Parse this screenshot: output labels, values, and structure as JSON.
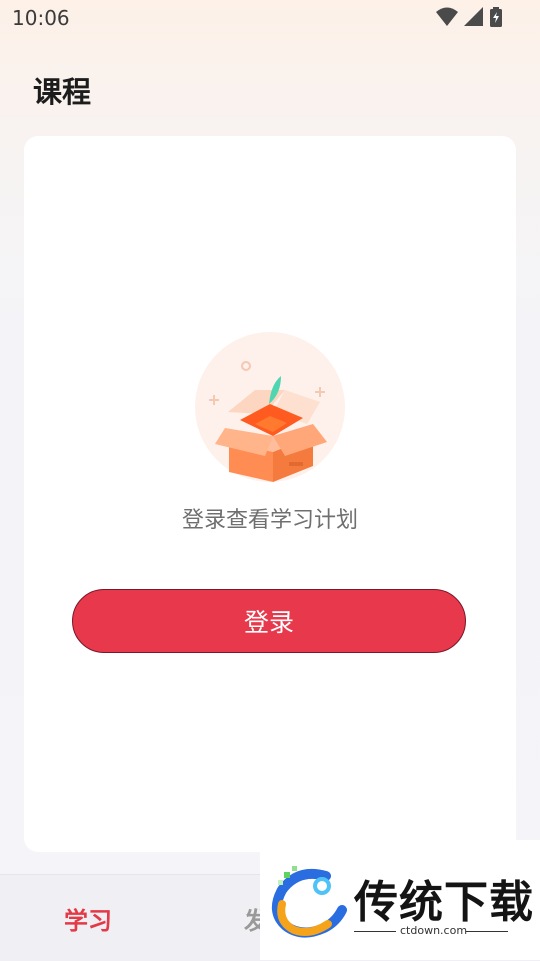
{
  "status_bar": {
    "time": "10:06",
    "icons": [
      "wifi-icon",
      "cellular-signal-icon",
      "battery-charging-icon"
    ]
  },
  "header": {
    "title": "课程"
  },
  "empty_state": {
    "illustration_icon": "gift-box-illustration",
    "message": "登录查看学习计划",
    "login_button_label": "登录"
  },
  "tab_bar": {
    "tabs": [
      {
        "label": "学习",
        "active": true
      },
      {
        "label": "发",
        "active": false
      }
    ]
  },
  "watermark": {
    "brand": "传统下载",
    "url": "ctdown.com"
  },
  "colors": {
    "accent": "#e8384b",
    "active_tab": "#e23a46",
    "inactive_tab": "#999999"
  }
}
